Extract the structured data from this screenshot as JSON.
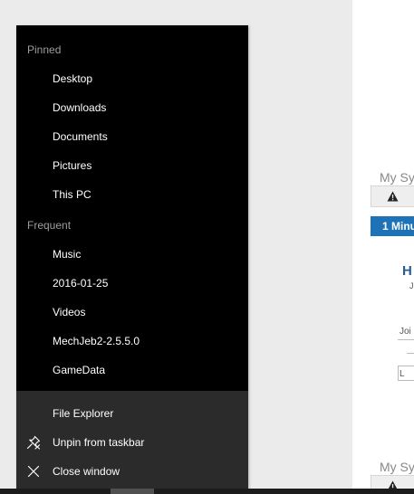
{
  "colors": {
    "jumplist_bg": "#000000",
    "tasks_bg": "#2b2b2b",
    "item_text": "#ffffff",
    "section_header_text": "#9d9d9d",
    "desktop_bg": "#ebebeb",
    "accent_tab": "#1e73b8"
  },
  "jumplist": {
    "pinned": {
      "header": "Pinned",
      "items": [
        "Desktop",
        "Downloads",
        "Documents",
        "Pictures",
        "This PC"
      ]
    },
    "frequent": {
      "header": "Frequent",
      "items": [
        "Music",
        "2016-01-25",
        "Videos",
        "MechJeb2-2.5.5.0",
        "GameData"
      ]
    },
    "tasks": [
      {
        "label": "File Explorer",
        "icon": "none"
      },
      {
        "label": "Unpin from taskbar",
        "icon": "unpin-icon"
      },
      {
        "label": "Close window",
        "icon": "close-icon"
      }
    ]
  },
  "background_page": {
    "heading_top": "My Sy",
    "heading_bottom": "My Sy",
    "tab_label": "1 Minu",
    "user_initial": "H",
    "user_sub": "J",
    "row1_label": "Joi",
    "row2_label": "L"
  }
}
